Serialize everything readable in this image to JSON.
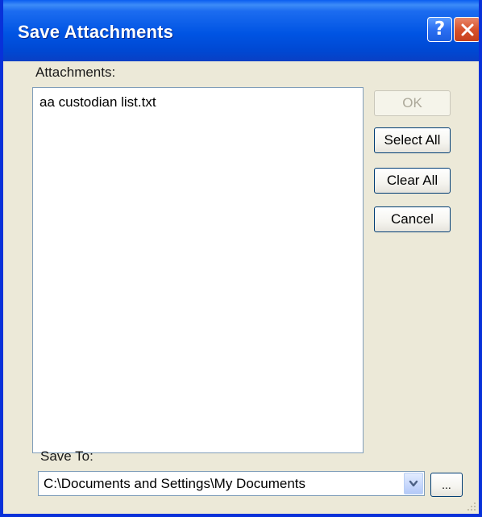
{
  "window": {
    "title": "Save Attachments",
    "help_label": "?"
  },
  "attachments": {
    "label": "Attachments:",
    "items": [
      "aa custodian list.txt"
    ]
  },
  "buttons": {
    "ok": "OK",
    "select_all": "Select All",
    "clear_all": "Clear All",
    "cancel": "Cancel",
    "browse": "..."
  },
  "save_to": {
    "label": "Save To:",
    "value": "C:\\Documents and Settings\\My Documents"
  },
  "colors": {
    "titlebar": "#0054e3",
    "dialog_bg": "#ece9d8",
    "close": "#d8532c"
  }
}
